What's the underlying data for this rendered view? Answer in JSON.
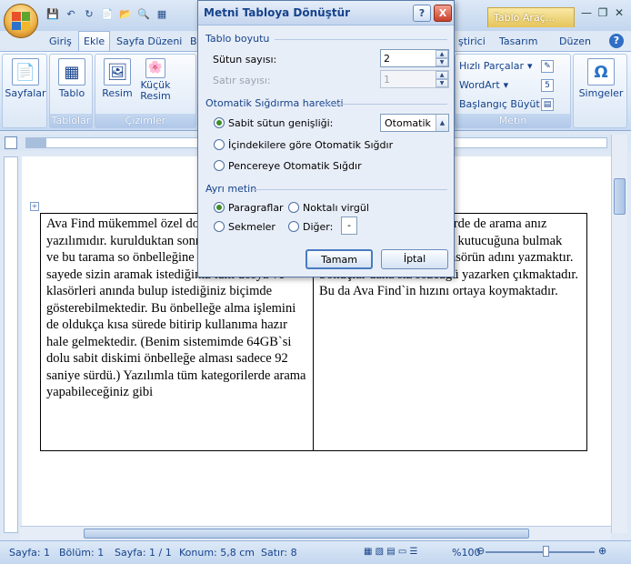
{
  "titlebar": {
    "doc_title_partial": "rd",
    "tool_tab": "Tablo Araç..."
  },
  "tabs": [
    {
      "label": "Giriş"
    },
    {
      "label": "Ekle"
    },
    {
      "label": "Sayfa Düzeni"
    },
    {
      "label": "B"
    },
    {
      "label": "ştirici"
    },
    {
      "label": "Tasarım"
    },
    {
      "label": "Düzen"
    }
  ],
  "ribbon": {
    "sayfalar": "Sayfalar",
    "tablo": "Tablo",
    "resim": "Resim",
    "kucuk_resim": "Küçük Resim",
    "group_tablolar": "Tablolar",
    "group_cizimler": "Çizimler",
    "hizli_parcalar": "Hızlı Parçalar",
    "wordart": "WordArt",
    "buyuk_harf": "Başlangıç Büyüt",
    "simgeler": "Simgeler",
    "group_metin": "Metin"
  },
  "dialog": {
    "title": "Metni Tabloya Dönüştür",
    "help": "?",
    "close": "X",
    "sec_boyut": "Tablo boyutu",
    "sutun_label": "Sütun sayısı:",
    "sutun_value": "2",
    "satir_label": "Satır sayısı:",
    "satir_value": "1",
    "sec_sigdirma": "Otomatik Sığdırma hareketi",
    "sabit_label": "Sabit sütun genişliği:",
    "sabit_value": "Otomatik",
    "icerik_label": "İçindekilere göre Otomatik Sığdır",
    "pencere_label": "Pencereye Otomatik Sığdır",
    "sec_ayri": "Ayrı metin",
    "paragraflar": "Paragraflar",
    "noktali": "Noktalı virgül",
    "sekmeler": "Sekmeler",
    "diger": "Diğer:",
    "diger_value": "-",
    "ok": "Tamam",
    "cancel": "İptal"
  },
  "document": {
    "cell1": "Ava Find mükemmel özel dosya arama yazılımıdır. kurulduktan sonra tüm sab taramakta ve bu tarama so önbelleğine kaydetmektedir. Bu sayede sizin aramak istediğiniz tüm dosya ve klasörleri anında bulup istediğiniz biçimde gösterebilmektedir. Bu önbelleğe alma işlemini de oldukça kısa sürede bitirip kullanıma hazır hale gelmektedir. (Benim sistemimde 64GB`si dolu sabit diskimi önbelleğe alması sadece 92 saniye sürdü.) Yazılımla tüm kategorilerde arama yapabileceğiniz gibi",
    "cell2": "ogram, indirilen ategorilerde de arama anız gereken tek şey ind\"(Bul) kutucuğuna bulmak istediğiniz dosya veya klasörün adını yazmaktır. Sonuçlar daha siz sözcüğü yazarken çıkmaktadır. Bu da Ava Find`in hızını ortaya koymaktadır."
  },
  "statusbar": {
    "sayfa": "Sayfa: 1",
    "bolum": "Bölüm: 1",
    "sayfa_of": "Sayfa: 1 / 1",
    "konum": "Konum: 5,8 cm",
    "satir": "Satır: 8",
    "zoom": "%100"
  }
}
